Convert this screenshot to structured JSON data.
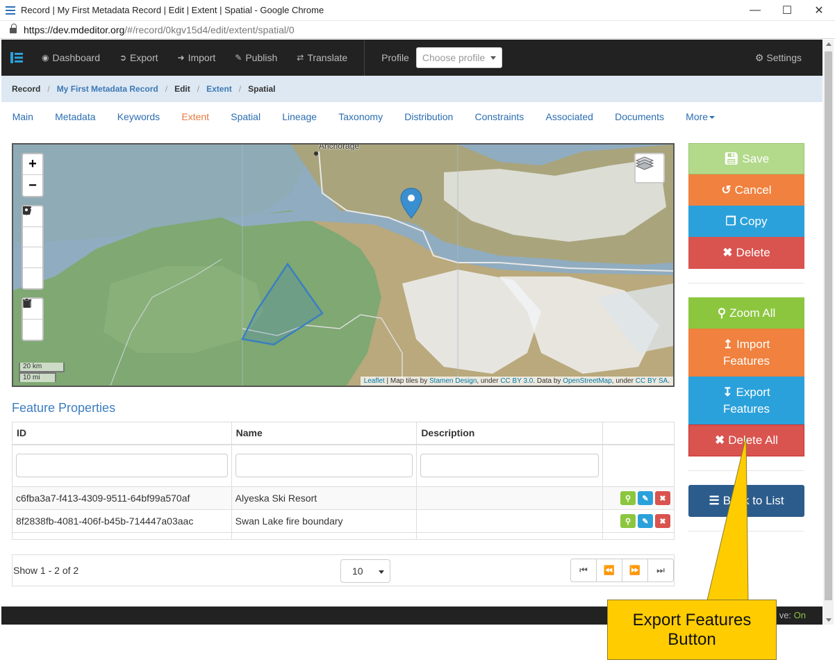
{
  "browser": {
    "window_title": "Record | My First Metadata Record | Edit | Extent | Spatial - Google Chrome",
    "url_host": "https://dev.mdeditor.org",
    "url_path": "/#/record/0kgv15d4/edit/extent/spatial/0"
  },
  "navbar": {
    "items": [
      "Dashboard",
      "Export",
      "Import",
      "Publish",
      "Translate"
    ],
    "profile_label": "Profile",
    "profile_placeholder": "Choose profile",
    "settings": "Settings"
  },
  "breadcrumb": [
    "Record",
    "My First Metadata Record",
    "Edit",
    "Extent",
    "Spatial"
  ],
  "tabs": [
    "Main",
    "Metadata",
    "Keywords",
    "Extent",
    "Spatial",
    "Lineage",
    "Taxonomy",
    "Distribution",
    "Constraints",
    "Associated",
    "Documents",
    "More"
  ],
  "active_tab": "Extent",
  "map": {
    "place_label": "Anchorage",
    "zoom_in": "+",
    "zoom_out": "−",
    "scale_km": "20 km",
    "scale_mi": "10 mi",
    "attribution": {
      "leaflet": "Leaflet",
      "t1": " | Map tiles by ",
      "stamen": "Stamen Design",
      "t2": ", under ",
      "ccby30": "CC BY 3.0",
      "t3": ". Data by ",
      "osm": "OpenStreetMap",
      "t4": ", under ",
      "ccbysa": "CC BY SA",
      "t5": "."
    },
    "colors": {
      "water": "#90acc0",
      "lowland": "#7fa872",
      "mountain": "#b9a97c",
      "snow": "#f2f4f6",
      "polygon": "#3a7fc1",
      "marker": "#3a8fd0"
    }
  },
  "feature_properties": {
    "title": "Feature Properties",
    "columns": [
      "ID",
      "Name",
      "Description"
    ],
    "rows": [
      {
        "id": "c6fba3a7-f413-4309-9511-64bf99a570af",
        "name": "Alyeska Ski Resort",
        "description": ""
      },
      {
        "id": "8f2838fb-4081-406f-b45b-714447a03aac",
        "name": "Swan Lake fire boundary",
        "description": ""
      }
    ],
    "show_text": "Show 1 - 2 of 2",
    "page_size": "10"
  },
  "side_buttons": {
    "save": "Save",
    "cancel": "Cancel",
    "copy": "Copy",
    "delete": "Delete",
    "zoom_all": "Zoom All",
    "import_1": "Import",
    "import_2": "Features",
    "export_1": "Export",
    "export_2": "Features",
    "delete_all": "Delete All",
    "back": "Back to List"
  },
  "button_colors": {
    "save": "#b3d98b",
    "cancel": "#f0813e",
    "copy": "#2ba1db",
    "delete": "#d9534f",
    "zoom_all": "#8cc63f",
    "back": "#2c5c8c"
  },
  "footer": {
    "text": "ve: ",
    "state": "On"
  },
  "callout": {
    "line1": "Export Features",
    "line2": "Button"
  }
}
